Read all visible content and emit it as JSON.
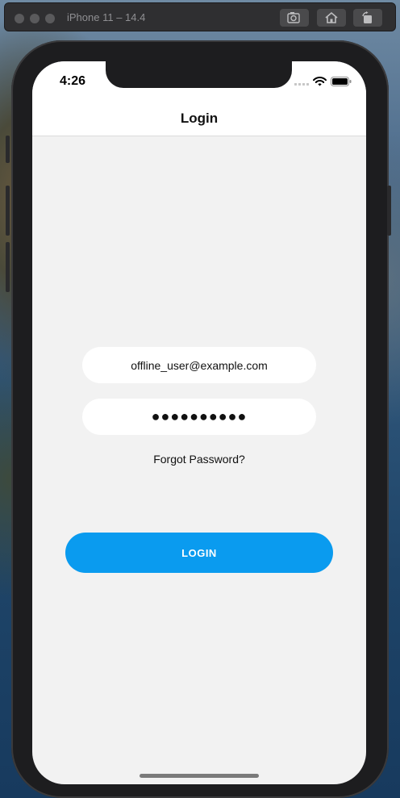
{
  "simulator": {
    "title": "iPhone 11 – 14.4",
    "toolbar_buttons": [
      "screenshot-icon",
      "home-icon",
      "rotate-icon"
    ]
  },
  "status_bar": {
    "time": "4:26",
    "icons": [
      "cellular-signal-icon",
      "wifi-icon",
      "battery-icon"
    ]
  },
  "nav": {
    "title": "Login"
  },
  "form": {
    "email_value": "offline_user@example.com",
    "password_value": "●●●●●●●●●●",
    "forgot_label": "Forgot Password?",
    "login_label": "LOGIN"
  },
  "colors": {
    "accent": "#0a9bef",
    "background": "#f2f2f2",
    "field_background": "#ffffff"
  }
}
